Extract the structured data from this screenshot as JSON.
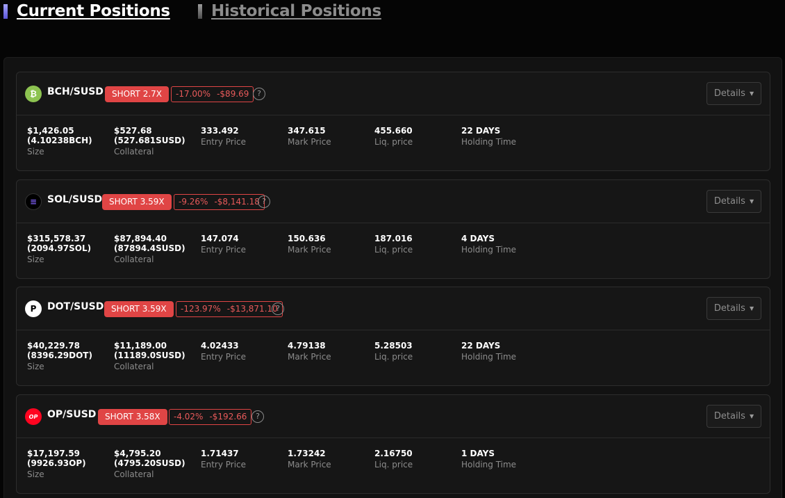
{
  "tabs": {
    "current": "Current Positions",
    "historical": "Historical Positions"
  },
  "positions": [
    {
      "pair": "BCH/SUSD",
      "icon": "bitcoin-cash-icon",
      "icon_glyph": "₿",
      "icon_bg": "#8dc351",
      "side": "SHORT 2.7X",
      "pnl_pct": "-17.00%",
      "pnl_usd": "-$89.69",
      "size_value": "$1,426.05",
      "size_qty": "(4.10238BCH)",
      "size_label": "Size",
      "collateral_value": "$527.68",
      "collateral_qty": "(527.681SUSD)",
      "collateral_label": "Collateral",
      "entry_price": "333.492",
      "entry_label": "Entry Price",
      "mark_price": "347.615",
      "mark_label": "Mark Price",
      "liq_price": "455.660",
      "liq_label": "Liq. price",
      "holding_time": "22 DAYS",
      "holding_label": "Holding Time",
      "details": "Details"
    },
    {
      "pair": "SOL/SUSD",
      "icon": "solana-icon",
      "icon_glyph": "≡",
      "icon_bg": "#000000",
      "side": "SHORT 3.59X",
      "pnl_pct": "-9.26%",
      "pnl_usd": "-$8,141.18",
      "size_value": "$315,578.37",
      "size_qty": "(2094.97SOL)",
      "size_label": "Size",
      "collateral_value": "$87,894.40",
      "collateral_qty": "(87894.4SUSD)",
      "collateral_label": "Collateral",
      "entry_price": "147.074",
      "entry_label": "Entry Price",
      "mark_price": "150.636",
      "mark_label": "Mark Price",
      "liq_price": "187.016",
      "liq_label": "Liq. price",
      "holding_time": "4 DAYS",
      "holding_label": "Holding Time",
      "details": "Details"
    },
    {
      "pair": "DOT/SUSD",
      "icon": "polkadot-icon",
      "icon_glyph": "P",
      "icon_bg": "#ffffff",
      "side": "SHORT 3.59X",
      "pnl_pct": "-123.97%",
      "pnl_usd": "-$13,871.10",
      "size_value": "$40,229.78",
      "size_qty": "(8396.29DOT)",
      "size_label": "Size",
      "collateral_value": "$11,189.00",
      "collateral_qty": "(11189.0SUSD)",
      "collateral_label": "Collateral",
      "entry_price": "4.02433",
      "entry_label": "Entry Price",
      "mark_price": "4.79138",
      "mark_label": "Mark Price",
      "liq_price": "5.28503",
      "liq_label": "Liq. price",
      "holding_time": "22 DAYS",
      "holding_label": "Holding Time",
      "details": "Details"
    },
    {
      "pair": "OP/SUSD",
      "icon": "optimism-icon",
      "icon_glyph": "OP",
      "icon_bg": "#ff0420",
      "side": "SHORT 3.58X",
      "pnl_pct": "-4.02%",
      "pnl_usd": "-$192.66",
      "size_value": "$17,197.59",
      "size_qty": "(9926.93OP)",
      "size_label": "Size",
      "collateral_value": "$4,795.20",
      "collateral_qty": "(4795.20SUSD)",
      "collateral_label": "Collateral",
      "entry_price": "1.71437",
      "entry_label": "Entry Price",
      "mark_price": "1.73242",
      "mark_label": "Mark Price",
      "liq_price": "2.16750",
      "liq_label": "Liq. price",
      "holding_time": "1 DAYS",
      "holding_label": "Holding Time",
      "details": "Details"
    }
  ],
  "help_glyph": "?",
  "caret_glyph": "▼",
  "colors": {
    "short": "#e04545",
    "accent_active": "#6f6ae8",
    "bg": "#050505"
  }
}
